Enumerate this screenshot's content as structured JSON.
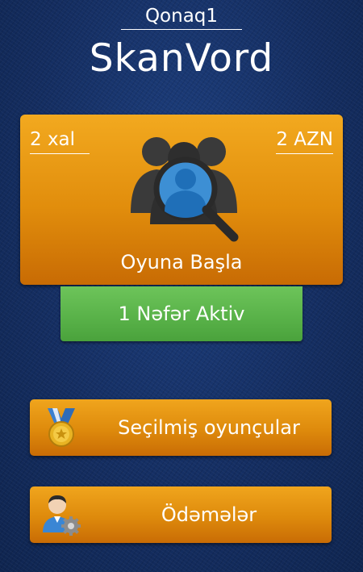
{
  "header": {
    "username": "Qonaq1",
    "app_title": "SkanVord"
  },
  "start_card": {
    "points": "2 xal",
    "price": "2 AZN",
    "icon": "players-search-icon",
    "label": "Oyuna Başla"
  },
  "active_status": {
    "label": "1 Nəfər Aktiv"
  },
  "menu": {
    "items": [
      {
        "label": "Seçilmiş oyunçular",
        "icon": "medal-icon"
      },
      {
        "label": "Ödəmələr",
        "icon": "user-settings-icon"
      }
    ]
  },
  "colors": {
    "background": "#16326a",
    "card_orange": "#e18d0c",
    "active_green": "#58b148",
    "text": "#ffffff"
  }
}
